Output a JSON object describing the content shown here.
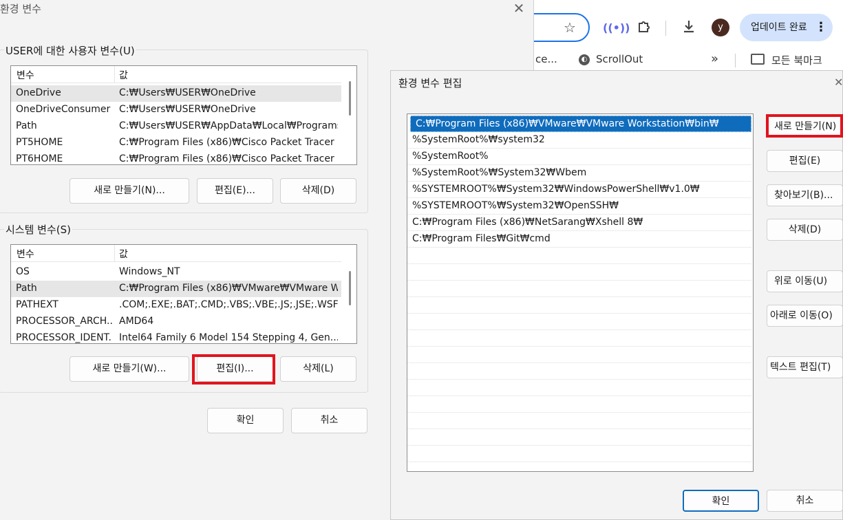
{
  "browser": {
    "update_button_label": "업데이트 완료",
    "avatar_letter": "y",
    "bookmarks": {
      "partial_label": "ce...",
      "scrollout_label": "ScrollOut",
      "more_label": "»",
      "all_bookmarks_label": "모든 북마크"
    }
  },
  "env_dialog": {
    "title": "환경 변수",
    "user_group": {
      "label": "USER에 대한 사용자 변수(U)",
      "columns": [
        "변수",
        "값"
      ],
      "rows": [
        {
          "name": "OneDrive",
          "value": "C:₩Users₩USER₩OneDrive",
          "selected": true
        },
        {
          "name": "OneDriveConsumer",
          "value": "C:₩Users₩USER₩OneDrive",
          "selected": false
        },
        {
          "name": "Path",
          "value": "C:₩Users₩USER₩AppData₩Local₩Programs...",
          "selected": false
        },
        {
          "name": "PT5HOME",
          "value": "C:₩Program Files (x86)₩Cisco Packet Tracer ...",
          "selected": false
        },
        {
          "name": "PT6HOME",
          "value": "C:₩Program Files (x86)₩Cisco Packet Tracer ...",
          "selected": false
        }
      ],
      "new_label": "새로 만들기(N)...",
      "edit_label": "편집(E)...",
      "delete_label": "삭제(D)"
    },
    "system_group": {
      "label": "시스템 변수(S)",
      "columns": [
        "변수",
        "값"
      ],
      "rows": [
        {
          "name": "OS",
          "value": "Windows_NT",
          "selected": false
        },
        {
          "name": "Path",
          "value": "C:₩Program Files (x86)₩VMware₩VMware W...",
          "selected": true
        },
        {
          "name": "PATHEXT",
          "value": ".COM;.EXE;.BAT;.CMD;.VBS;.VBE;.JS;.JSE;.WSF;...",
          "selected": false
        },
        {
          "name": "PROCESSOR_ARCH...",
          "value": "AMD64",
          "selected": false
        },
        {
          "name": "PROCESSOR_IDENT...",
          "value": "Intel64 Family 6 Model 154 Stepping 4, Gen...",
          "selected": false
        }
      ],
      "new_label": "새로 만들기(W)...",
      "edit_label": "편집(I)...",
      "delete_label": "삭제(L)"
    },
    "ok_label": "확인",
    "cancel_label": "취소"
  },
  "edit_dialog": {
    "title": "환경 변수 편집",
    "paths": [
      "C:₩Program Files (x86)₩VMware₩VMware Workstation₩bin₩",
      "%SystemRoot%₩system32",
      "%SystemRoot%",
      "%SystemRoot%₩System32₩Wbem",
      "%SYSTEMROOT%₩System32₩WindowsPowerShell₩v1.0₩",
      "%SYSTEMROOT%₩System32₩OpenSSH₩",
      "C:₩Program Files (x86)₩NetSarang₩Xshell 8₩",
      "C:₩Program Files₩Git₩cmd"
    ],
    "selected_index": 0,
    "buttons": {
      "new": "새로 만들기(N)",
      "edit": "편집(E)",
      "browse": "찾아보기(B)...",
      "delete": "삭제(D)",
      "move_up": "위로 이동(U)",
      "move_down": "아래로 이동(O)",
      "edit_text": "텍스트 편집(T)"
    },
    "ok_label": "확인",
    "cancel_label": "취소"
  },
  "colors": {
    "highlight_red": "#e0141e",
    "selection_blue": "#0f6cbd",
    "omnibox_focus": "#1a73e8",
    "update_pill": "#d3e3fd"
  }
}
